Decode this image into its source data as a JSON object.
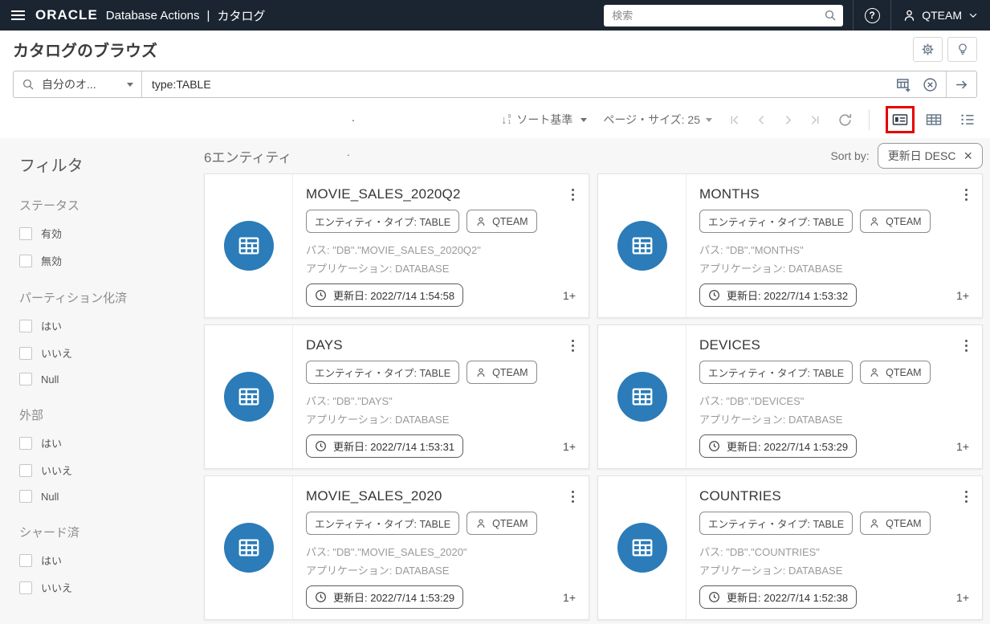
{
  "header": {
    "brand": "ORACLE",
    "product": "Database Actions",
    "divider": "|",
    "page": "カタログ",
    "search_placeholder": "検索",
    "user_name": "QTEAM"
  },
  "page_title": {
    "title": "カタログのブラウズ"
  },
  "search_bar": {
    "scope_label": "自分のオ...",
    "query_value": "type:TABLE"
  },
  "toolbar": {
    "stray_dot": ".",
    "sort_label": "ソート基準",
    "sort_icon_digits": [
      "9",
      "1"
    ],
    "page_size_label": "ページ・サイズ: 25"
  },
  "results_bar": {
    "count": "6エンティティ",
    "stray_dot": ".",
    "sort_by_label": "Sort by:",
    "sort_chip_label": "更新日 DESC",
    "sort_chip_close": "×"
  },
  "filters": {
    "title": "フィルタ",
    "sections": [
      {
        "label": "ステータス",
        "options": [
          "有効",
          "無効"
        ]
      },
      {
        "label": "パーティション化済",
        "options": [
          "はい",
          "いいえ",
          "Null"
        ]
      },
      {
        "label": "外部",
        "options": [
          "はい",
          "いいえ",
          "Null"
        ]
      },
      {
        "label": "シャード済",
        "options": [
          "はい",
          "いいえ"
        ]
      }
    ]
  },
  "cards": [
    {
      "title": "MOVIE_SALES_2020Q2",
      "entity_chip": "エンティティ・タイプ: TABLE",
      "owner": "QTEAM",
      "path": "パス: \"DB\".\"MOVIE_SALES_2020Q2\"",
      "application": "アプリケーション: DATABASE",
      "updated": "更新日: 2022/7/14 1:54:58",
      "more": "1+"
    },
    {
      "title": "MONTHS",
      "entity_chip": "エンティティ・タイプ: TABLE",
      "owner": "QTEAM",
      "path": "パス: \"DB\".\"MONTHS\"",
      "application": "アプリケーション: DATABASE",
      "updated": "更新日: 2022/7/14 1:53:32",
      "more": "1+"
    },
    {
      "title": "DAYS",
      "entity_chip": "エンティティ・タイプ: TABLE",
      "owner": "QTEAM",
      "path": "パス: \"DB\".\"DAYS\"",
      "application": "アプリケーション: DATABASE",
      "updated": "更新日: 2022/7/14 1:53:31",
      "more": "1+"
    },
    {
      "title": "DEVICES",
      "entity_chip": "エンティティ・タイプ: TABLE",
      "owner": "QTEAM",
      "path": "パス: \"DB\".\"DEVICES\"",
      "application": "アプリケーション: DATABASE",
      "updated": "更新日: 2022/7/14 1:53:29",
      "more": "1+"
    },
    {
      "title": "MOVIE_SALES_2020",
      "entity_chip": "エンティティ・タイプ: TABLE",
      "owner": "QTEAM",
      "path": "パス: \"DB\".\"MOVIE_SALES_2020\"",
      "application": "アプリケーション: DATABASE",
      "updated": "更新日: 2022/7/14 1:53:29",
      "more": "1+"
    },
    {
      "title": "COUNTRIES",
      "entity_chip": "エンティティ・タイプ: TABLE",
      "owner": "QTEAM",
      "path": "パス: \"DB\".\"COUNTRIES\"",
      "application": "アプリケーション: DATABASE",
      "updated": "更新日: 2022/7/14 1:52:38",
      "more": "1+"
    }
  ],
  "colors": {
    "header_bg": "#1b2531",
    "accent_blue": "#2b7cb8",
    "highlight_red": "#e60000",
    "muted_text": "#9a9a9a"
  }
}
